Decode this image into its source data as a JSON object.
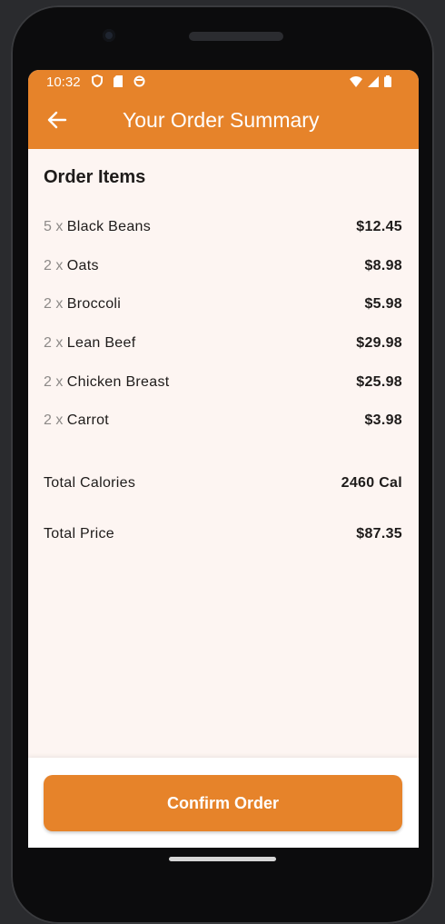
{
  "status_bar": {
    "time": "10:32"
  },
  "app_bar": {
    "title": "Your Order Summary"
  },
  "order": {
    "section_title": "Order Items",
    "items": [
      {
        "qty": "5 x ",
        "name": "Black Beans",
        "price": "$12.45"
      },
      {
        "qty": "2 x ",
        "name": "Oats",
        "price": "$8.98"
      },
      {
        "qty": "2 x ",
        "name": "Broccoli",
        "price": "$5.98"
      },
      {
        "qty": "2 x ",
        "name": "Lean Beef",
        "price": "$29.98"
      },
      {
        "qty": "2 x ",
        "name": "Chicken Breast",
        "price": "$25.98"
      },
      {
        "qty": "2 x ",
        "name": "Carrot",
        "price": "$3.98"
      }
    ],
    "total_calories_label": "Total Calories",
    "total_calories_value": "2460 Cal",
    "total_price_label": "Total Price",
    "total_price_value": "$87.35"
  },
  "actions": {
    "confirm_label": "Confirm Order"
  },
  "colors": {
    "accent": "#e6832a",
    "background": "#fdf5f2"
  }
}
